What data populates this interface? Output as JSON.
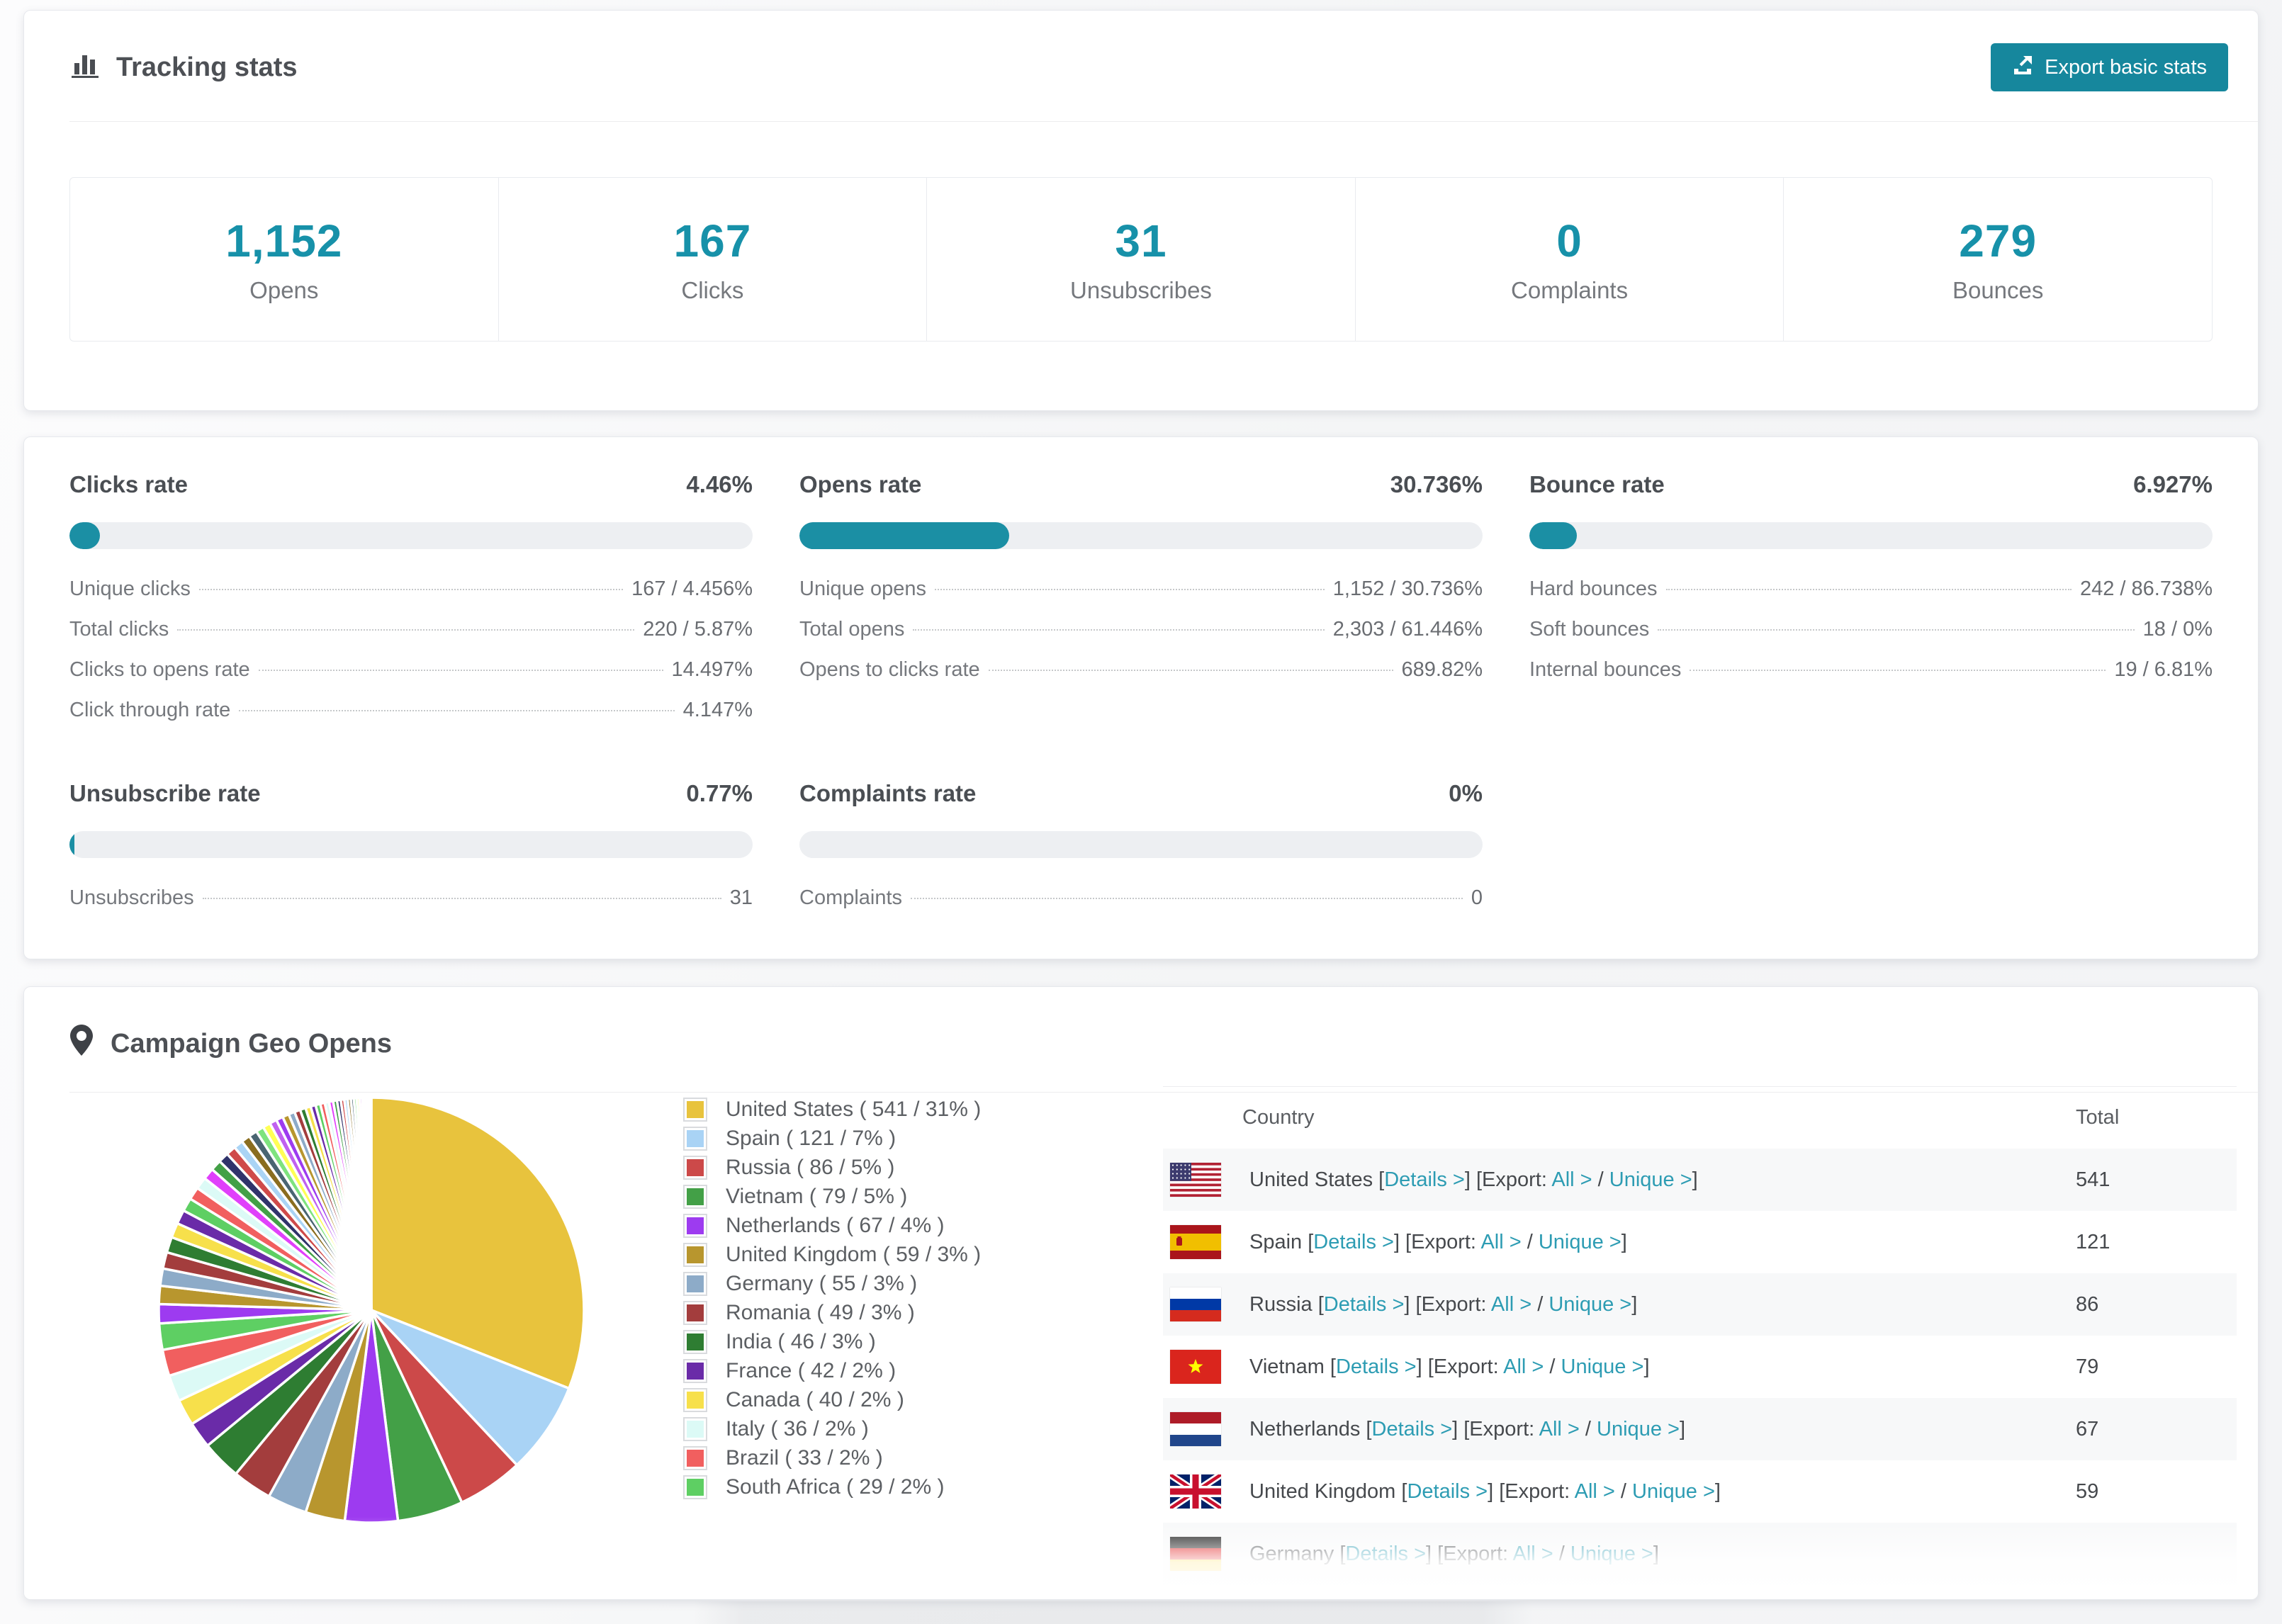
{
  "colors": {
    "accent": "#1791a9",
    "button": "#16879d",
    "link": "#2d9cb3",
    "bar_fill": "#1b8fa4",
    "bar_track": "#edeff2"
  },
  "tracking": {
    "title": "Tracking stats",
    "export_button": "Export basic stats"
  },
  "summary": [
    {
      "value": "1,152",
      "label": "Opens"
    },
    {
      "value": "167",
      "label": "Clicks"
    },
    {
      "value": "31",
      "label": "Unsubscribes"
    },
    {
      "value": "0",
      "label": "Complaints"
    },
    {
      "value": "279",
      "label": "Bounces"
    }
  ],
  "rates": [
    {
      "title": "Clicks rate",
      "value": "4.46%",
      "pct": 4.46,
      "items": [
        [
          "Unique clicks",
          "167 / 4.456%"
        ],
        [
          "Total clicks",
          "220 / 5.87%"
        ],
        [
          "Clicks to opens rate",
          "14.497%"
        ],
        [
          "Click through rate",
          "4.147%"
        ]
      ]
    },
    {
      "title": "Opens rate",
      "value": "30.736%",
      "pct": 30.736,
      "items": [
        [
          "Unique opens",
          "1,152 / 30.736%"
        ],
        [
          "Total opens",
          "2,303 / 61.446%"
        ],
        [
          "Opens to clicks rate",
          "689.82%"
        ]
      ]
    },
    {
      "title": "Bounce rate",
      "value": "6.927%",
      "pct": 6.927,
      "items": [
        [
          "Hard bounces",
          "242 / 86.738%"
        ],
        [
          "Soft bounces",
          "18 / 0%"
        ],
        [
          "Internal bounces",
          "19 / 6.81%"
        ]
      ]
    },
    {
      "title": "Unsubscribe rate",
      "value": "0.77%",
      "pct": 0.77,
      "items": [
        [
          "Unsubscribes",
          "31"
        ]
      ]
    },
    {
      "title": "Complaints rate",
      "value": "0%",
      "pct": 0,
      "items": [
        [
          "Complaints",
          "0"
        ]
      ]
    }
  ],
  "geo": {
    "title": "Campaign Geo Opens",
    "chart_data": {
      "type": "pie",
      "title": "Campaign Geo Opens",
      "legend_position": "right",
      "start_angle_deg": -90,
      "slices": [
        {
          "label": "United States",
          "value": 541,
          "pct": 31,
          "color": "#e8c33d"
        },
        {
          "label": "Spain",
          "value": 121,
          "pct": 7,
          "color": "#a9d3f5"
        },
        {
          "label": "Russia",
          "value": 86,
          "pct": 5,
          "color": "#cc4949"
        },
        {
          "label": "Vietnam",
          "value": 79,
          "pct": 5,
          "color": "#43a047"
        },
        {
          "label": "Netherlands",
          "value": 67,
          "pct": 4,
          "color": "#9d3bf0"
        },
        {
          "label": "United Kingdom",
          "value": 59,
          "pct": 3,
          "color": "#b8962e"
        },
        {
          "label": "Germany",
          "value": 55,
          "pct": 3,
          "color": "#8dabc8"
        },
        {
          "label": "Romania",
          "value": 49,
          "pct": 3,
          "color": "#a33d3d"
        },
        {
          "label": "India",
          "value": 46,
          "pct": 3,
          "color": "#2e7d32"
        },
        {
          "label": "France",
          "value": 42,
          "pct": 2,
          "color": "#6a2ba8"
        },
        {
          "label": "Canada",
          "value": 40,
          "pct": 2,
          "color": "#f7e04b"
        },
        {
          "label": "Italy",
          "value": 36,
          "pct": 2,
          "color": "#dcfaf6"
        },
        {
          "label": "Brazil",
          "value": 33,
          "pct": 2,
          "color": "#f15f5f"
        },
        {
          "label": "South Africa",
          "value": 29,
          "pct": 2,
          "color": "#5ecf63"
        }
      ],
      "others_tail": {
        "note": "unlabeled long tail of tiny country slices",
        "total_pct": 26,
        "slice_count": 44
      }
    },
    "legend": [
      "United States ( 541 / 31% )",
      "Spain ( 121 / 7% )",
      "Russia ( 86 / 5% )",
      "Vietnam ( 79 / 5% )",
      "Netherlands ( 67 / 4% )",
      "United Kingdom ( 59 / 3% )",
      "Germany ( 55 / 3% )",
      "Romania ( 49 / 3% )",
      "India ( 46 / 3% )",
      "France ( 42 / 2% )",
      "Canada ( 40 / 2% )",
      "Italy ( 36 / 2% )",
      "Brazil ( 33 / 2% )",
      "South Africa ( 29 / 2% )"
    ],
    "table": {
      "columns": [
        "Country",
        "Total"
      ],
      "details_label": "Details >",
      "export_label": "Export:",
      "all_label": "All >",
      "unique_label": "Unique >",
      "rows": [
        {
          "country": "United States",
          "flag": "us",
          "total": "541"
        },
        {
          "country": "Spain",
          "flag": "es",
          "total": "121"
        },
        {
          "country": "Russia",
          "flag": "ru",
          "total": "86"
        },
        {
          "country": "Vietnam",
          "flag": "vn",
          "total": "79"
        },
        {
          "country": "Netherlands",
          "flag": "nl",
          "total": "67"
        },
        {
          "country": "United Kingdom",
          "flag": "gb",
          "total": "59"
        },
        {
          "country": "Germany",
          "flag": "de",
          "total": ""
        }
      ]
    }
  }
}
